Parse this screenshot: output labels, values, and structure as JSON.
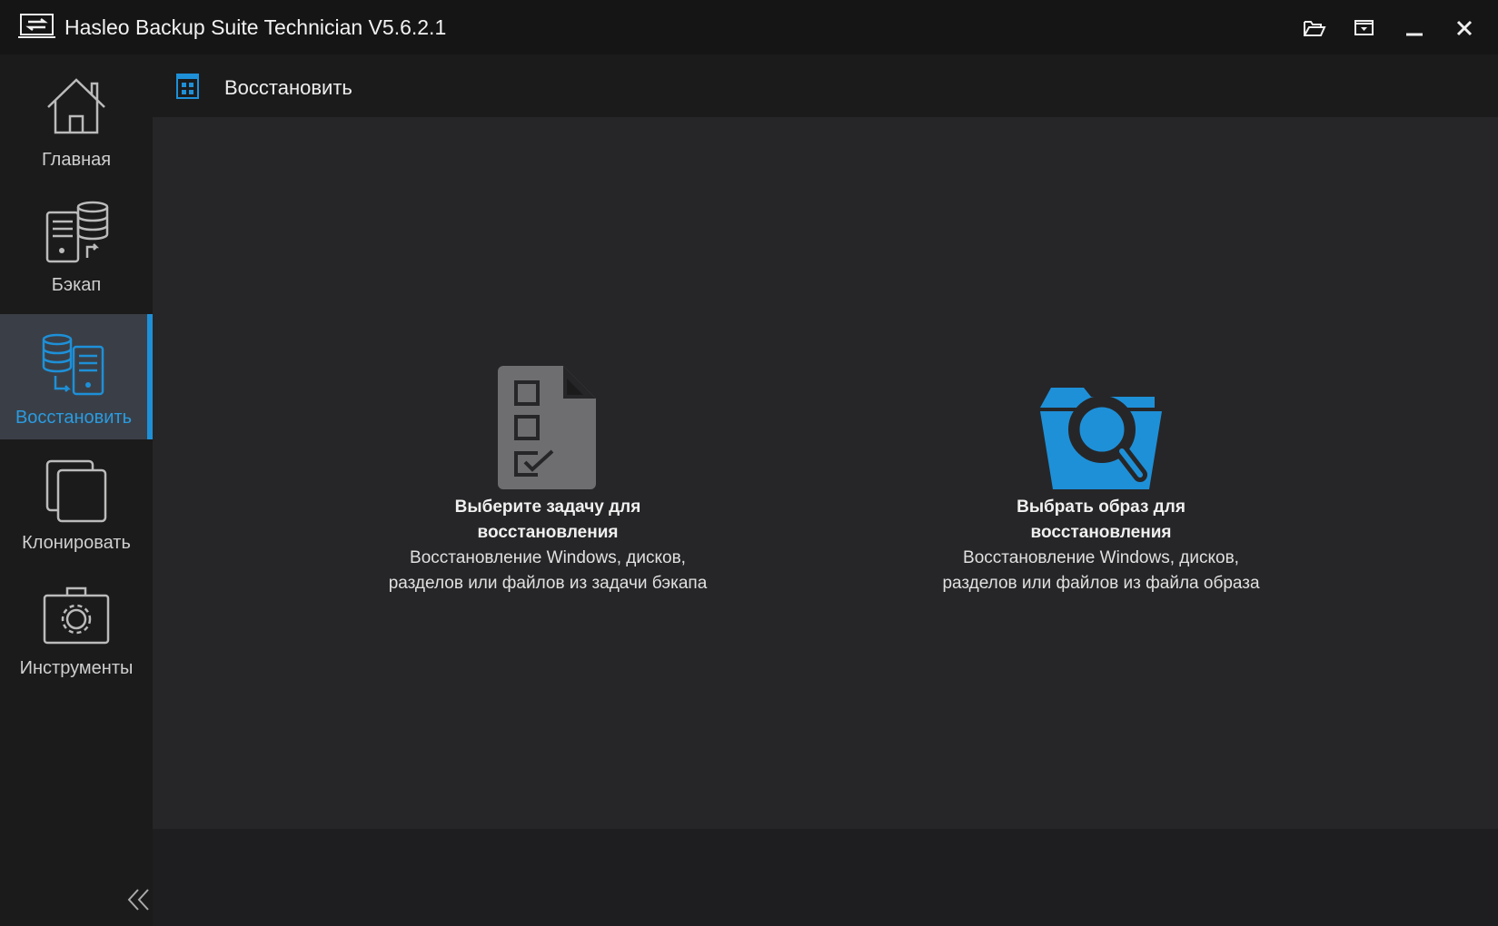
{
  "window": {
    "title": "Hasleo Backup Suite Technician V5.6.2.1"
  },
  "sidebar": {
    "items": [
      {
        "label": "Главная",
        "icon": "home-icon"
      },
      {
        "label": "Бэкап",
        "icon": "backup-icon"
      },
      {
        "label": "Восстановить",
        "icon": "restore-icon",
        "active": true
      },
      {
        "label": "Клонировать",
        "icon": "clone-icon"
      },
      {
        "label": "Инструменты",
        "icon": "tools-icon"
      }
    ]
  },
  "header": {
    "title": "Восстановить"
  },
  "cards": [
    {
      "title": "Выберите задачу для восстановления",
      "desc": "Восстановление Windows, дисков, разделов или файлов из задачи бэкапа"
    },
    {
      "title": "Выбрать образ для восстановления",
      "desc": "Восстановление Windows, дисков, разделов или файлов из файла образа"
    }
  ],
  "colors": {
    "accent": "#1e90d8",
    "background": "#262628"
  }
}
